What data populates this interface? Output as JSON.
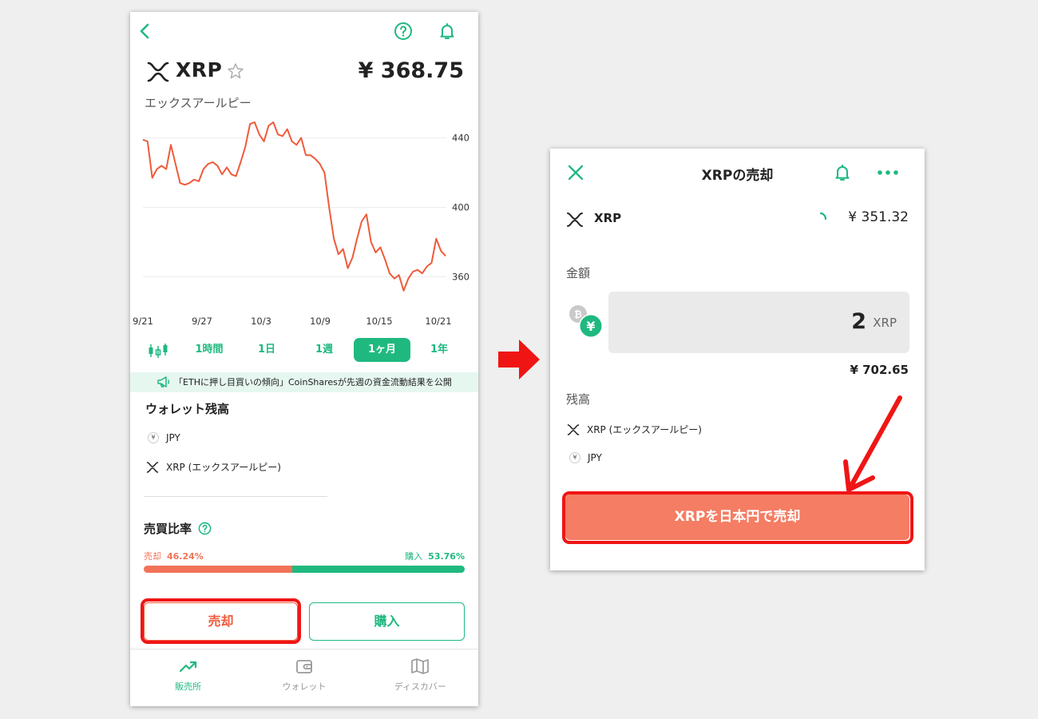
{
  "left": {
    "coin": {
      "symbol": "XRP",
      "name": "エックスアールピー",
      "price": "¥ 368.75"
    },
    "chart_data": {
      "type": "line",
      "x": [
        "9/21",
        "9/27",
        "10/3",
        "10/9",
        "10/15",
        "10/21"
      ],
      "y_ticks": [
        "440",
        "400",
        "360"
      ],
      "ylim": [
        340,
        455
      ],
      "values": [
        439,
        438,
        417,
        422,
        424,
        422,
        436,
        425,
        414,
        413,
        414,
        416,
        415,
        422,
        425,
        426,
        424,
        419,
        423,
        419,
        418,
        426,
        435,
        448,
        449,
        442,
        438,
        447,
        449,
        442,
        441,
        445,
        438,
        436,
        440,
        430,
        430,
        428,
        425,
        420,
        400,
        382,
        373,
        376,
        365,
        371,
        382,
        392,
        396,
        380,
        374,
        377,
        370,
        362,
        359,
        361,
        352,
        359,
        363,
        364,
        362,
        366,
        368,
        382,
        375,
        372
      ],
      "color": "#f05a3a"
    },
    "periods": [
      "1時間",
      "1日",
      "1週",
      "1ヶ月",
      "1年"
    ],
    "active_period": "1ヶ月",
    "news": "「ETHに押し目買いの傾向」CoinSharesが先週の資金流動結果を公開",
    "wallet": {
      "title": "ウォレット残高",
      "items": [
        "JPY",
        "XRP (エックスアールピー)"
      ]
    },
    "ratio": {
      "title": "売買比率",
      "sell_label": "売却",
      "sell_pct": "46.24%",
      "buy_label": "購入",
      "buy_pct": "53.76%",
      "sell_fraction": 0.4624
    },
    "buttons": {
      "sell": "売却",
      "buy": "購入"
    },
    "tabs": [
      {
        "label": "販売所",
        "icon": "trend-icon",
        "active": true
      },
      {
        "label": "ウォレット",
        "icon": "wallet-icon",
        "active": false
      },
      {
        "label": "ディスカバー",
        "icon": "map-icon",
        "active": false
      }
    ]
  },
  "right": {
    "title": "XRPの売却",
    "coin": {
      "symbol": "XRP",
      "price": "¥ 351.32"
    },
    "amount": {
      "label": "金額",
      "value": "2",
      "unit": "XRP",
      "yen_total": "¥ 702.65"
    },
    "balance": {
      "title": "残高",
      "items": [
        "XRP (エックスアールピー)",
        "JPY"
      ]
    },
    "action_button": "XRPを日本円で売却"
  },
  "colors": {
    "accent_green": "#1fb980",
    "sell_red": "#f05a3a",
    "highlight_red": "#f01515",
    "sell_button_fill": "#f47d63"
  }
}
